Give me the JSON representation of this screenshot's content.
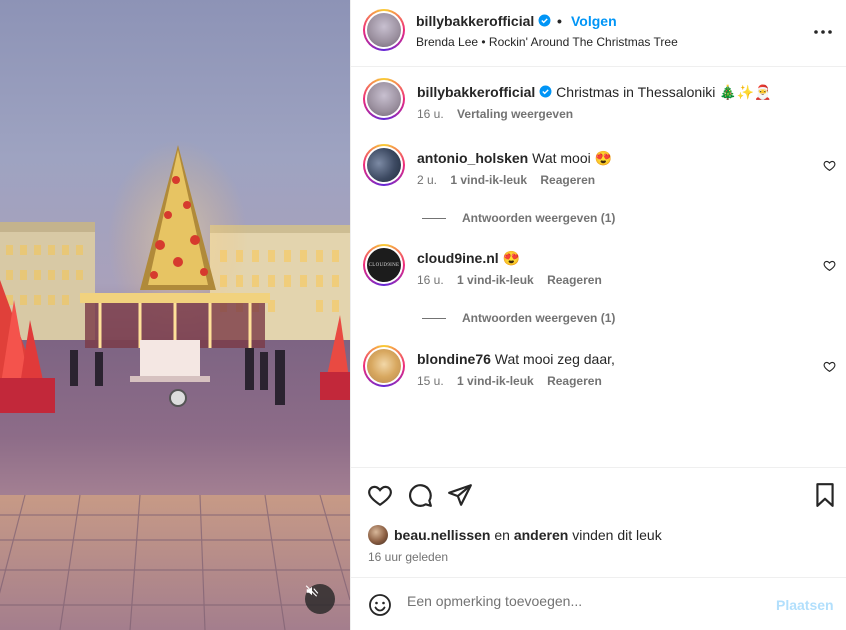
{
  "header": {
    "username": "billybakkerofficial",
    "separator": "•",
    "follow_label": "Volgen",
    "audio": "Brenda Lee • Rockin' Around The Christmas Tree"
  },
  "caption": {
    "username": "billybakkerofficial",
    "text": "Christmas in Thessaloniki 🎄✨🎅",
    "time": "16 u.",
    "translate_label": "Vertaling weergeven"
  },
  "comments": [
    {
      "username": "antonio_holsken",
      "text": "Wat mooi 😍",
      "time": "2 u.",
      "likes": "1 vind-ik-leuk",
      "reply_label": "Reageren",
      "replies_label": "Antwoorden weergeven (1)"
    },
    {
      "username": "cloud9ine.nl",
      "text": "😍",
      "time": "16 u.",
      "likes": "1 vind-ik-leuk",
      "reply_label": "Reageren",
      "replies_label": "Antwoorden weergeven (1)",
      "avatar_text": "CLOUD9INE"
    },
    {
      "username": "blondine76",
      "text": "Wat mooi zeg daar,",
      "time": "15 u.",
      "likes": "1 vind-ik-leuk",
      "reply_label": "Reageren"
    }
  ],
  "likes": {
    "user": "beau.nellissen",
    "connector": " en ",
    "others": "anderen",
    "suffix": " vinden dit leuk"
  },
  "posted_ago": "16 uur geleden",
  "composer": {
    "placeholder": "Een opmerking toevoegen...",
    "post_label": "Plaatsen"
  },
  "icons": {
    "verified": "verified-badge-icon",
    "more": "more-options-icon",
    "like": "heart-icon",
    "comment": "comment-bubble-icon",
    "share": "paper-plane-icon",
    "save": "bookmark-icon",
    "emoji": "smiley-icon",
    "mute": "speaker-muted-icon"
  },
  "colors": {
    "accent": "#0095f6",
    "post_disabled": "#b2dffc",
    "secondary_text": "#737373"
  }
}
